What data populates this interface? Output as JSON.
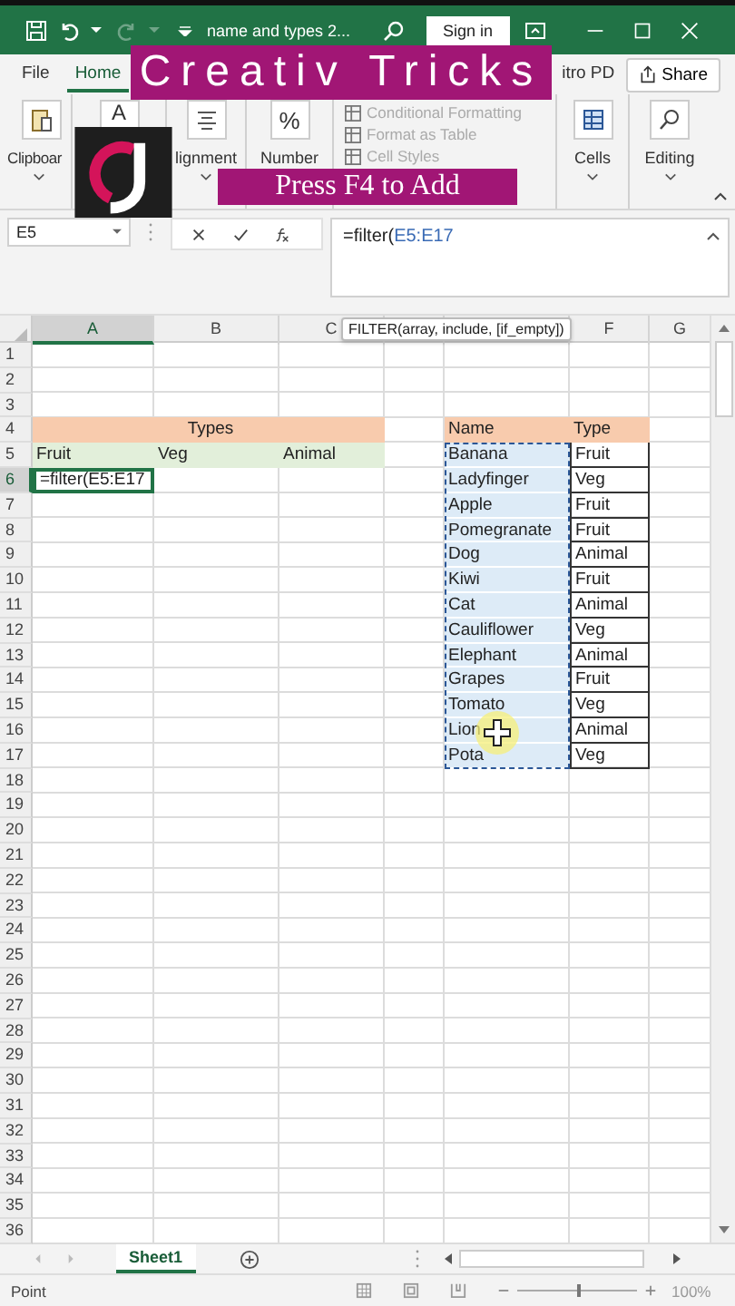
{
  "title_bar": {
    "title": "name and types 2...",
    "sign_in": "Sign in",
    "redo_disabled": true
  },
  "ribbon_tabs": [
    {
      "label": "File",
      "selected": false
    },
    {
      "label": "Home",
      "selected": true
    },
    {
      "label": "itro PD",
      "selected": false
    }
  ],
  "share": "Share",
  "ribbon_groups": [
    {
      "kind": "clipboard",
      "label": "Clipboar"
    },
    {
      "kind": "font",
      "glyph": "A"
    },
    {
      "kind": "alignment",
      "label": "lignment"
    },
    {
      "kind": "number",
      "glyph": "%",
      "label": "Number"
    },
    {
      "kind": "styles",
      "items": [
        {
          "label": "Conditional Formatting",
          "disabled": true
        },
        {
          "label": "Format as Table",
          "disabled": true
        },
        {
          "label": "Cell Styles",
          "disabled": true
        }
      ]
    },
    {
      "kind": "cells",
      "label": "Cells"
    },
    {
      "kind": "editing",
      "label": "Editing"
    }
  ],
  "overlays": {
    "brand": "Creativ Tricks",
    "caption": "Press F4 to Add"
  },
  "formula_bar": {
    "name_box": "E5",
    "formula": "=filter(",
    "reference": "E5:E17"
  },
  "tooltip": "FILTER(array, include, [if_empty])",
  "columns": [
    {
      "label": "A",
      "selected": true
    },
    {
      "label": "B",
      "selected": false
    },
    {
      "label": "C",
      "selected": false
    },
    {
      "selected": false
    },
    {
      "selected": false
    },
    {
      "label": "F",
      "selected": false
    },
    {
      "label": "G",
      "selected": false
    }
  ],
  "rows": [
    {
      "label": "1",
      "selected": false
    },
    {
      "label": "2",
      "selected": false
    },
    {
      "label": "3",
      "selected": false
    },
    {
      "label": "4",
      "selected": false
    },
    {
      "label": "5",
      "selected": false
    },
    {
      "label": "6",
      "selected": true
    },
    {
      "label": "7",
      "selected": false
    },
    {
      "label": "8",
      "selected": false
    },
    {
      "label": "9",
      "selected": false
    },
    {
      "label": "10",
      "selected": false
    },
    {
      "label": "11",
      "selected": false
    },
    {
      "label": "12",
      "selected": false
    },
    {
      "label": "13",
      "selected": false
    },
    {
      "label": "14",
      "selected": false
    },
    {
      "label": "15",
      "selected": false
    },
    {
      "label": "16",
      "selected": false
    },
    {
      "label": "17",
      "selected": false
    },
    {
      "label": "18",
      "selected": false
    },
    {
      "label": "19",
      "selected": false
    },
    {
      "label": "20",
      "selected": false
    },
    {
      "label": "21",
      "selected": false
    },
    {
      "label": "22",
      "selected": false
    },
    {
      "label": "23",
      "selected": false
    },
    {
      "label": "24",
      "selected": false
    },
    {
      "label": "25",
      "selected": false
    },
    {
      "label": "26",
      "selected": false
    },
    {
      "label": "27",
      "selected": false
    },
    {
      "label": "28",
      "selected": false
    },
    {
      "label": "29",
      "selected": false
    },
    {
      "label": "30",
      "selected": false
    },
    {
      "label": "31",
      "selected": false
    },
    {
      "label": "32",
      "selected": false
    },
    {
      "label": "33",
      "selected": false
    },
    {
      "label": "34",
      "selected": false
    },
    {
      "label": "35",
      "selected": false
    },
    {
      "label": "36",
      "selected": false
    }
  ],
  "types_table": {
    "title": "Types",
    "headers": [
      "Fruit",
      "Veg",
      "Animal"
    ]
  },
  "active_cell": {
    "value": "=filter(E5:E17"
  },
  "source_table": {
    "headers": [
      "Name",
      "Type"
    ],
    "rows": [
      [
        "Banana",
        "Fruit"
      ],
      [
        "Ladyfinger",
        "Veg"
      ],
      [
        "Apple",
        "Fruit"
      ],
      [
        "Pomegranate",
        "Fruit"
      ],
      [
        "Dog",
        "Animal"
      ],
      [
        "Kiwi",
        "Fruit"
      ],
      [
        "Cat",
        "Animal"
      ],
      [
        "Cauliflower",
        "Veg"
      ],
      [
        "Elephant",
        "Animal"
      ],
      [
        "Grapes",
        "Fruit"
      ],
      [
        "Tomato",
        "Veg"
      ],
      [
        "Lion",
        "Animal"
      ],
      [
        "Pota",
        "Veg"
      ]
    ]
  },
  "sheet_tabs": [
    {
      "label": "Sheet1",
      "selected": true
    }
  ],
  "status_bar": {
    "mode": "Point",
    "zoom": "100%",
    "zoom_slider": {
      "level": 0.5
    }
  }
}
